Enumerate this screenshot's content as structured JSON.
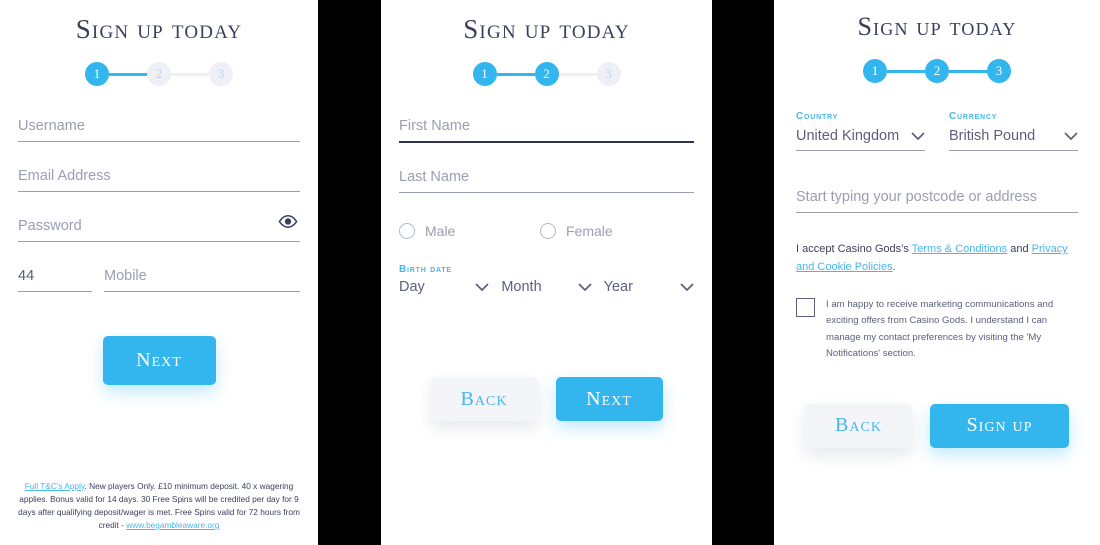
{
  "brand": {
    "accent": "#33b5ee",
    "accent_link": "#49b6ef",
    "title_color": "#3b3f5c",
    "placeholder_color": "#9b9db3",
    "inactive_step_bg": "#eef0f5",
    "secondary_button_bg": "#f4f5f9",
    "gutter_color": "#000000"
  },
  "panel1": {
    "title": "Sign up today",
    "steps": [
      {
        "label": "1",
        "state": "active"
      },
      {
        "label": "2",
        "state": "inactive"
      },
      {
        "label": "3",
        "state": "inactive"
      }
    ],
    "fields": {
      "username": {
        "placeholder": "Username",
        "value": ""
      },
      "email": {
        "placeholder": "Email Address",
        "value": ""
      },
      "password": {
        "placeholder": "Password",
        "value": "",
        "reveal_icon": "eye-icon"
      },
      "country_code": {
        "placeholder": "44",
        "value": "44"
      },
      "mobile": {
        "placeholder": "Mobile",
        "value": ""
      }
    },
    "next_label": "Next",
    "footer": {
      "link1": "Full T&C's Apply",
      "body": ". New players Only. £10 minimum deposit. 40 x wagering applies. Bonus valid for 14 days. 30 Free Spins will be credited per day for 9 days after qualifying deposit/wager is met. Free Spins valid for 72 hours from credit - ",
      "link2": "www.begambleaware.org"
    }
  },
  "panel2": {
    "title": "Sign up today",
    "steps": [
      {
        "label": "1",
        "state": "active"
      },
      {
        "label": "2",
        "state": "active"
      },
      {
        "label": "3",
        "state": "inactive"
      }
    ],
    "fields": {
      "first_name": {
        "placeholder": "First Name",
        "value": ""
      },
      "last_name": {
        "placeholder": "Last Name",
        "value": ""
      }
    },
    "gender": {
      "male_label": "Male",
      "female_label": "Female",
      "selected": ""
    },
    "birth_date": {
      "label": "Birth date",
      "day": "Day",
      "month": "Month",
      "year": "Year"
    },
    "back_label": "Back",
    "next_label": "Next"
  },
  "panel3": {
    "title": "Sign up today",
    "steps": [
      {
        "label": "1",
        "state": "active"
      },
      {
        "label": "2",
        "state": "active"
      },
      {
        "label": "3",
        "state": "active"
      }
    ],
    "country": {
      "label": "Country",
      "value": "United Kingdom"
    },
    "currency": {
      "label": "Currency",
      "value": "British Pound"
    },
    "address": {
      "placeholder": "Start typing your postcode or address",
      "value": ""
    },
    "accept": {
      "prefix": "I accept Casino Gods’s ",
      "link1": "Terms & Conditions",
      "middle": " and ",
      "link2": "Privacy and Cookie Policies",
      "suffix": "."
    },
    "marketing": {
      "checked": false,
      "text": "I am happy to receive marketing communications and exciting offers from Casino Gods. I understand I can manage my contact preferences by visiting the 'My Notifications' section."
    },
    "back_label": "Back",
    "signup_label": "Sign up"
  }
}
